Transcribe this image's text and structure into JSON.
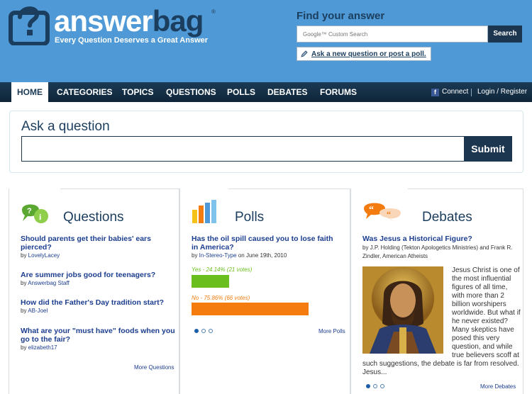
{
  "header": {
    "brand_white": "answer",
    "brand_dark": "bag",
    "reg_mark": "®",
    "tagline": "Every Question Deserves a Great Answer",
    "find_label": "Find your answer",
    "search_placeholder": "Google™ Custom Search",
    "search_button": "Search",
    "ask_link": "Ask a new question or post a poll."
  },
  "nav": {
    "items": [
      "HOME",
      "CATEGORIES",
      "TOPICS",
      "QUESTIONS",
      "POLLS",
      "DEBATES",
      "FORUMS"
    ],
    "connect": "Connect",
    "login": "Login / Register"
  },
  "ask": {
    "title": "Ask a question",
    "input_value": "",
    "submit": "Submit"
  },
  "questions": {
    "title": "Questions",
    "items": [
      {
        "q": "Should parents get their babies' ears pierced?",
        "by": "by ",
        "user": "LovelyLacey"
      },
      {
        "q": "Are summer jobs good for teenagers?",
        "by": "by ",
        "user": "Answerbag Staff"
      },
      {
        "q": "How did the Father's Day tradition start?",
        "by": "by ",
        "user": "AB-Joel"
      },
      {
        "q": "What are your \"must have\" foods when you go to the fair?",
        "by": "by ",
        "user": "elizabeth17"
      }
    ],
    "more": "More Questions"
  },
  "polls": {
    "title": "Polls",
    "question": "Has the oil spill caused you to lose faith in America?",
    "by": "by ",
    "user": "In-Stereo-Type",
    "date": " on June 19th, 2010",
    "options": [
      {
        "label": "Yes - 24.14% (21 votes)",
        "percent": 24.14,
        "color": "#6abf1e"
      },
      {
        "label": "No - 75.86% (66 votes)",
        "percent": 75.86,
        "color": "#f47c0e"
      }
    ],
    "more": "More Polls"
  },
  "debates": {
    "title": "Debates",
    "question": "Was Jesus a Historical Figure?",
    "by": "by J.P. Holding (Tekton Apologetics Ministries) and Frank R. Zindler, American Atheists",
    "side_lines": [
      "Jesus Christ is one of",
      "the most influential",
      "figures of all time,",
      "with more than 2",
      "billion worshipers",
      "worldwide. But what if",
      "he never existed?",
      "Many skeptics have",
      "posed this very",
      "question, and while",
      "true believers scoff at"
    ],
    "tail_lines": [
      "such suggestions, the debate is far from resolved.",
      "Jesus..."
    ],
    "more": "More Debates"
  },
  "colors": {
    "header_blue": "#4f9ad6",
    "navy": "#1c3650",
    "link_blue": "#1c3e8f"
  }
}
